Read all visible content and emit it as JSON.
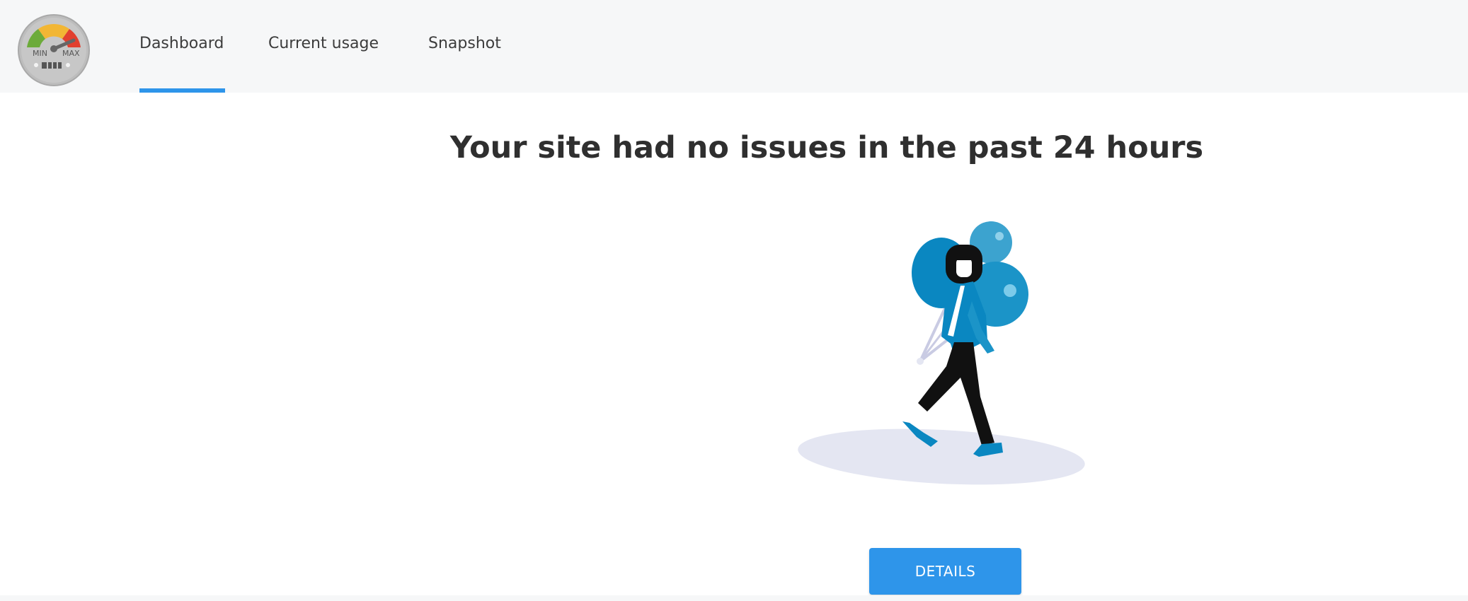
{
  "header": {
    "logo": {
      "icon": "speedometer-gauge-icon",
      "min_label": "MIN",
      "max_label": "MAX"
    },
    "tabs": [
      {
        "label": "Dashboard",
        "active": true
      },
      {
        "label": "Current usage",
        "active": false
      },
      {
        "label": "Snapshot",
        "active": false
      }
    ]
  },
  "main": {
    "headline": "Your site had no issues in the past 24 hours",
    "illustration": "woman-with-balloons-illustration",
    "details_button": "DETAILS"
  },
  "colors": {
    "accent": "#2e95ea",
    "balloon": "#0a87c1",
    "header_bg": "#f6f7f8",
    "text": "#333333"
  }
}
